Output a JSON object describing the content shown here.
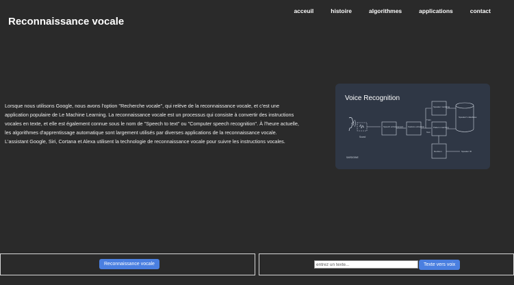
{
  "site": {
    "title": "Reconnaissance vocale"
  },
  "nav": {
    "items": [
      "acceuil",
      "histoire",
      "algorithmes",
      "applications",
      "contact"
    ]
  },
  "intro": {
    "text": "Lorsque nous utilisons Google, nous avons l'option \"Recherche vocale\", qui relève de la reconnaissance vocale, et c'est une application populaire de Le Machine Learning. La reconnaissance vocale est un processus qui consiste à convertir des instructions vocales en texte, et elle est également connue sous le nom de \"Speech to text\" ou \"Computer speech recognition\". À l'heure actuelle, les algorithmes d'apprentissage automatique sont largement utilisés par diverses applications de la reconnaissance vocale. L'assistant Google, Siri, Cortana et Alexa utilisent la technologie de reconnaissance vocale pour suivre les instructions vocales."
  },
  "diagram": {
    "title": "Voice Recognition",
    "sound_label": "Sound",
    "speech_enh": "Speech enhancement",
    "feature_ext": "Feature extraction",
    "speaker_model": "Speaker modeling",
    "pattern_match": "Pattern matching",
    "decision": "Decision",
    "database": "Speaker's database",
    "train_label": "Train",
    "test_label": "Test",
    "speaker_id": "Speaker ID",
    "brand": "SARDOINE"
  },
  "controls": {
    "recognize_button": "Reconnaissance vocale",
    "text_placeholder": "entrez un texte...",
    "tts_button": "Texte vers voix"
  },
  "colors": {
    "background": "#2a2a2a",
    "button": "#4a7fe0",
    "card": "#2f3745"
  }
}
